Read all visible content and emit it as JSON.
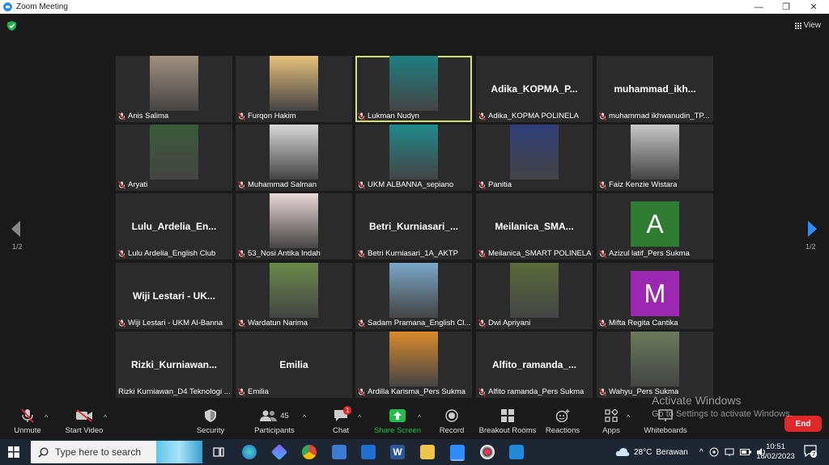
{
  "window": {
    "title": "Zoom Meeting",
    "minimize_glyph": "—",
    "restore_glyph": "❐",
    "close_glyph": "✕"
  },
  "meeting": {
    "view_label": "View",
    "page_left": "1/2",
    "page_right": "1/2",
    "tiles": [
      {
        "label": "Anis Salima",
        "kind": "photo",
        "photo_color": "#a09080"
      },
      {
        "label": "Furqon Hakim",
        "kind": "photo",
        "photo_color": "#e8c27a"
      },
      {
        "label": "Lukman Nudyn",
        "kind": "photo",
        "photo_color": "#1e7f80",
        "active": true
      },
      {
        "label": "Adika_KOPMA POLINELA",
        "kind": "text",
        "big": "Adika_KOPMA_P..."
      },
      {
        "label": "muhammad ikhwanudin_TP...",
        "kind": "text",
        "big": "muhammad_ikh..."
      },
      {
        "label": "Aryati",
        "kind": "photo",
        "photo_color": "#3a5a3a"
      },
      {
        "label": "Muhammad Salman",
        "kind": "photo",
        "photo_color": "#d9d9d9"
      },
      {
        "label": "UKM ALBANNA_sepiano",
        "kind": "photo",
        "photo_color": "#1e8a8a"
      },
      {
        "label": "Panitia",
        "kind": "photo",
        "photo_color": "#2f3f7a"
      },
      {
        "label": "Faiz Kenzie Wistara",
        "kind": "photo",
        "photo_color": "#c8c8c8"
      },
      {
        "label": "Lulu Ardelia_English Club",
        "kind": "text",
        "big": "Lulu_Ardelia_En..."
      },
      {
        "label": "53_Nosi Antika Indah",
        "kind": "photo",
        "photo_color": "#e9d8d8"
      },
      {
        "label": "Betri Kurniasari_1A_AKTP",
        "kind": "text",
        "big": "Betri_Kurniasari_..."
      },
      {
        "label": "Meilanica_SMART POLINELA",
        "kind": "text",
        "big": "Meilanica_SMA..."
      },
      {
        "label": "Azizul latif_Pers Sukma",
        "kind": "letter",
        "letter": "A",
        "letter_color": "#2e7d32"
      },
      {
        "label": "Wiji Lestari - UKM Al-Banna",
        "kind": "text",
        "big": "Wiji Lestari - UK..."
      },
      {
        "label": "Wardatun Narima",
        "kind": "photo",
        "photo_color": "#6a8a4a"
      },
      {
        "label": "Sadam Pramana_English Cl...",
        "kind": "photo",
        "photo_color": "#7aa8c8"
      },
      {
        "label": "Dwi Apriyani",
        "kind": "photo",
        "photo_color": "#5a6a3a"
      },
      {
        "label": "Mifta Regita Cantika",
        "kind": "letter",
        "letter": "M",
        "letter_color": "#9c27b0"
      },
      {
        "label": "Rizki Kurniawan_D4 Teknologi ...",
        "kind": "text",
        "big": "Rizki_Kurniawan...",
        "nomic": true
      },
      {
        "label": "Emilia",
        "kind": "text",
        "big": "Emilia"
      },
      {
        "label": "Ardilla Karisma_Pers Sukma",
        "kind": "photo",
        "photo_color": "#d98a2a"
      },
      {
        "label": "Alfito ramanda_Pers Sukma",
        "kind": "text",
        "big": "Alfito_ramanda_..."
      },
      {
        "label": "Wahyu_Pers Sukma",
        "kind": "photo",
        "photo_color": "#6a7a5a"
      }
    ]
  },
  "toolbar": {
    "unmute": "Unmute",
    "start_video": "Start Video",
    "security": "Security",
    "participants": "Participants",
    "participants_count": "45",
    "chat": "Chat",
    "chat_badge": "1",
    "share_screen": "Share Screen",
    "record": "Record",
    "breakout_rooms": "Breakout Rooms",
    "reactions": "Reactions",
    "apps": "Apps",
    "whiteboards": "Whiteboards",
    "end": "End",
    "share_color": "#1fbf4a",
    "end_color": "#e02828"
  },
  "watermark": {
    "line1": "Activate Windows",
    "line2": "Go to Settings to activate Windows."
  },
  "taskbar": {
    "search_placeholder": "Type here to search",
    "weather_temp": "28°C",
    "weather_text": "Berawan",
    "time": "10:51",
    "date": "18/02/2023",
    "notification_count": "7"
  }
}
